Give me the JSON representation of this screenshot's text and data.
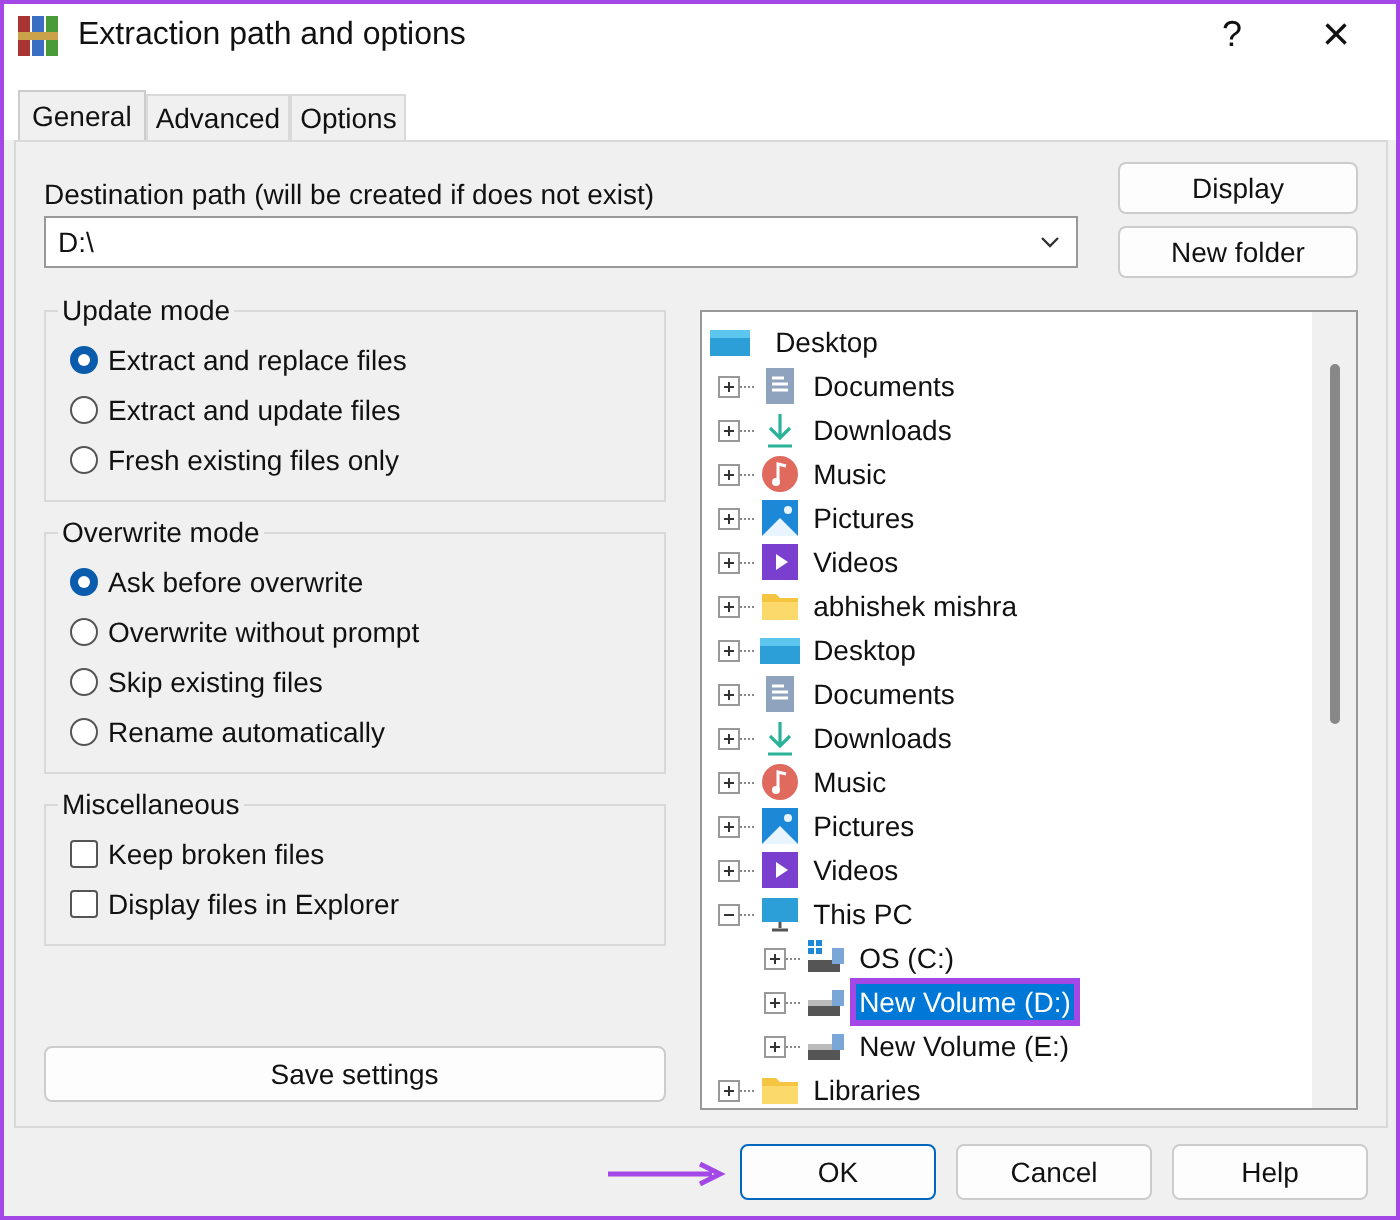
{
  "window": {
    "title": "Extraction path and options",
    "help": "?",
    "close": "×"
  },
  "tabs": [
    {
      "label": "General",
      "selected": true
    },
    {
      "label": "Advanced",
      "selected": false
    },
    {
      "label": "Options",
      "selected": false
    }
  ],
  "destination": {
    "label": "Destination path (will be created if does not exist)",
    "value": "D:\\"
  },
  "side_buttons": [
    "Display",
    "New folder"
  ],
  "update_mode": {
    "title": "Update mode",
    "options": [
      {
        "label": "Extract and replace files",
        "selected": true
      },
      {
        "label": "Extract and update files",
        "selected": false
      },
      {
        "label": "Fresh existing files only",
        "selected": false
      }
    ]
  },
  "overwrite_mode": {
    "title": "Overwrite mode",
    "options": [
      {
        "label": "Ask before overwrite",
        "selected": true
      },
      {
        "label": "Overwrite without prompt",
        "selected": false
      },
      {
        "label": "Skip existing files",
        "selected": false
      },
      {
        "label": "Rename automatically",
        "selected": false
      }
    ]
  },
  "miscellaneous": {
    "title": "Miscellaneous",
    "options": [
      {
        "label": "Keep broken files",
        "checked": false
      },
      {
        "label": "Display files in Explorer",
        "checked": false
      }
    ]
  },
  "save_button": "Save settings",
  "tree": {
    "root": {
      "label": "Desktop",
      "kind": "desktop"
    },
    "children": [
      {
        "label": "Documents",
        "kind": "documents",
        "expanded": false,
        "selected": false
      },
      {
        "label": "Downloads",
        "kind": "downloads",
        "expanded": false,
        "selected": false
      },
      {
        "label": "Music",
        "kind": "music",
        "expanded": false,
        "selected": false
      },
      {
        "label": "Pictures",
        "kind": "pictures",
        "expanded": false,
        "selected": false
      },
      {
        "label": "Videos",
        "kind": "videos",
        "expanded": false,
        "selected": false
      },
      {
        "label": "abhishek mishra",
        "kind": "folder",
        "expanded": false,
        "selected": false
      },
      {
        "label": "Desktop",
        "kind": "desktop",
        "expanded": false,
        "selected": false
      },
      {
        "label": "Documents",
        "kind": "documents",
        "expanded": false,
        "selected": false
      },
      {
        "label": "Downloads",
        "kind": "downloads",
        "expanded": false,
        "selected": false
      },
      {
        "label": "Music",
        "kind": "music",
        "expanded": false,
        "selected": false
      },
      {
        "label": "Pictures",
        "kind": "pictures",
        "expanded": false,
        "selected": false
      },
      {
        "label": "Videos",
        "kind": "videos",
        "expanded": false,
        "selected": false
      },
      {
        "label": "This PC",
        "kind": "pc",
        "expanded": true,
        "selected": false,
        "children": [
          {
            "label": "OS (C:)",
            "kind": "system-drive",
            "expanded": false,
            "selected": false
          },
          {
            "label": "New Volume (D:)",
            "kind": "drive",
            "expanded": false,
            "selected": true,
            "highlighted": true
          },
          {
            "label": "New Volume (E:)",
            "kind": "drive",
            "expanded": false,
            "selected": false
          }
        ]
      },
      {
        "label": "Libraries",
        "kind": "folder",
        "expanded": false,
        "selected": false
      }
    ]
  },
  "buttons": [
    {
      "label": "OK",
      "default": true,
      "pointed": true
    },
    {
      "label": "Cancel",
      "default": false,
      "pointed": false
    },
    {
      "label": "Help",
      "default": false,
      "pointed": false
    }
  ]
}
